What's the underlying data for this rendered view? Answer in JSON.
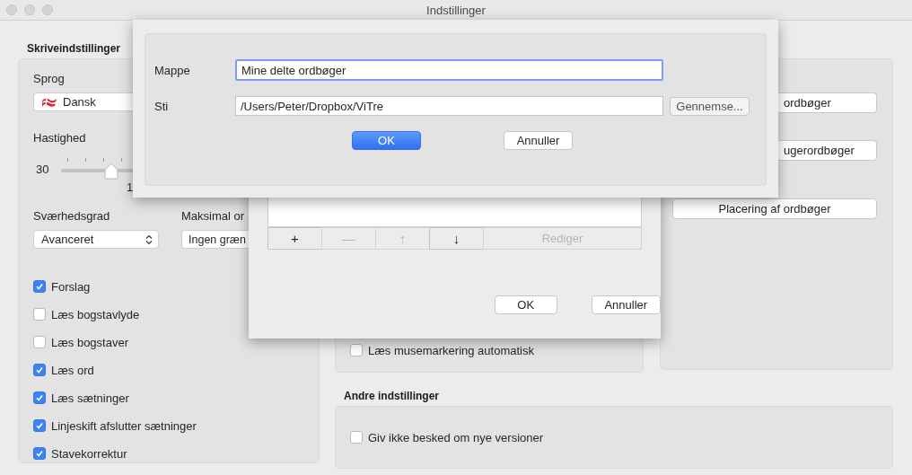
{
  "window": {
    "title": "Indstillinger"
  },
  "writing": {
    "title": "Skriveindstillinger",
    "language": {
      "label": "Sprog",
      "value": "Dansk"
    },
    "speed": {
      "label": "Hastighed",
      "min": "30",
      "tick_label": "1",
      "level": 0.2
    },
    "difficulty": {
      "label": "Sværhedsgrad",
      "value": "Avanceret"
    },
    "max_words": {
      "label": "Maksimal or",
      "value": "Ingen græn"
    },
    "options": [
      {
        "label": "Forslag",
        "checked": true
      },
      {
        "label": "Læs bogstavlyde",
        "checked": false
      },
      {
        "label": "Læs bogstaver",
        "checked": false
      },
      {
        "label": "Læs ord",
        "checked": true
      },
      {
        "label": "Læs sætninger",
        "checked": true
      },
      {
        "label": "Linjeskift afslutter sætninger",
        "checked": true
      },
      {
        "label": "Stavekorrektur",
        "checked": true
      }
    ]
  },
  "reading": {
    "options": [
      {
        "label": "Læs musemarkering automatisk",
        "checked": false
      }
    ]
  },
  "dictionaries": {
    "buttons": [
      {
        "label": "ordbøger",
        "kind": "partial"
      },
      {
        "label": "ugerordbøger",
        "kind": "partial"
      },
      {
        "label": "Placering af ordbøger",
        "kind": "full"
      }
    ]
  },
  "other": {
    "title": "Andre indstillinger",
    "options": [
      {
        "label": "Giv ikke besked om nye versioner",
        "checked": false
      }
    ]
  },
  "list_sheet": {
    "toolbar": [
      {
        "label": "+",
        "disabled": false,
        "kind": "icon"
      },
      {
        "label": "—",
        "disabled": true,
        "kind": "icon"
      },
      {
        "label": "↑",
        "disabled": true,
        "kind": "icon"
      },
      {
        "label": "↓",
        "disabled": false,
        "kind": "icon"
      },
      {
        "label": "Rediger",
        "disabled": true,
        "kind": "text"
      }
    ],
    "buttons": [
      {
        "label": "OK",
        "primary": false
      },
      {
        "label": "Annuller",
        "primary": false
      }
    ]
  },
  "folder_sheet": {
    "fields": [
      {
        "label": "Mappe",
        "value": "Mine delte ordbøger",
        "focused": true
      },
      {
        "label": "Sti",
        "value": "/Users/Peter/Dropbox/ViTre",
        "focused": false
      }
    ],
    "browse": "Gennemse...",
    "buttons": [
      {
        "label": "OK",
        "primary": true
      },
      {
        "label": "Annuller",
        "primary": false
      }
    ]
  }
}
